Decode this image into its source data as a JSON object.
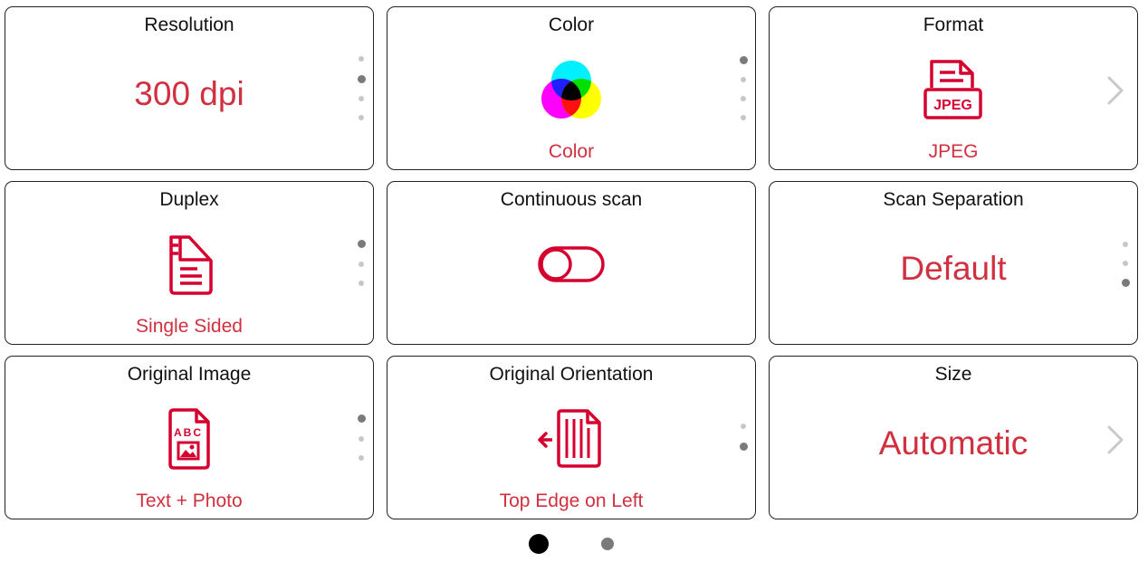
{
  "tiles": {
    "resolution": {
      "title": "Resolution",
      "value": "300 dpi",
      "dot_count": 4,
      "active_dot": 2
    },
    "color": {
      "title": "Color",
      "value": "Color",
      "icon": "color-circles-icon",
      "dot_count": 4,
      "active_dot": 1
    },
    "format": {
      "title": "Format",
      "value": "JPEG",
      "icon": "jpeg-file-icon",
      "badge": "JPEG",
      "has_next": true
    },
    "duplex": {
      "title": "Duplex",
      "value": "Single Sided",
      "icon": "single-sided-page-icon",
      "dot_count": 3,
      "active_dot": 1
    },
    "continuous": {
      "title": "Continuous scan",
      "icon": "toggle-switch-icon",
      "state": "off"
    },
    "separation": {
      "title": "Scan Separation",
      "value": "Default",
      "dot_count": 3,
      "active_dot": 3
    },
    "original_image": {
      "title": "Original Image",
      "value": "Text + Photo",
      "icon": "text-photo-document-icon",
      "icon_text": "ABC",
      "dot_count": 3,
      "active_dot": 1
    },
    "orientation": {
      "title": "Original Orientation",
      "value": "Top Edge on Left",
      "icon": "orientation-left-icon",
      "dot_count": 2,
      "active_dot": 2
    },
    "size": {
      "title": "Size",
      "value": "Automatic",
      "has_next": true
    }
  },
  "pager": {
    "page_count": 2,
    "current_page": 1
  },
  "colors": {
    "accent": "#d0303f",
    "icon_red": "#d6002f",
    "border": "#222222",
    "dot_active": "#7a7a7a",
    "dot_inactive": "#c7c7c7"
  }
}
